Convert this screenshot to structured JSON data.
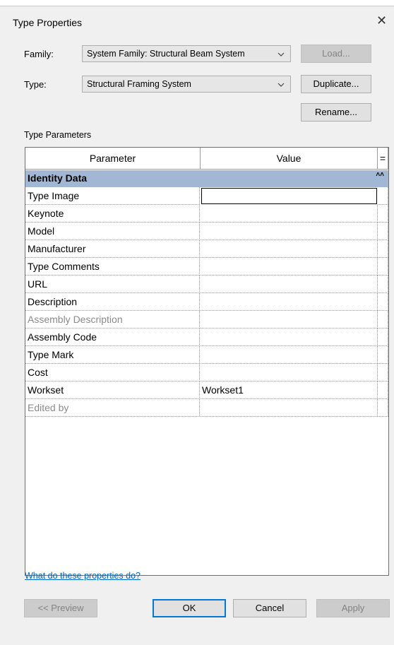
{
  "window": {
    "title": "Type Properties"
  },
  "family": {
    "label": "Family:",
    "value": "System Family: Structural Beam System"
  },
  "type": {
    "label": "Type:",
    "value": "Structural Framing System"
  },
  "buttons": {
    "load": "Load...",
    "duplicate": "Duplicate...",
    "rename": "Rename..."
  },
  "section_label": "Type Parameters",
  "table": {
    "headers": {
      "parameter": "Parameter",
      "value": "Value",
      "sort": "="
    },
    "group": "Identity Data",
    "rows": [
      {
        "parameter": "Type Image",
        "value": ""
      },
      {
        "parameter": "Keynote",
        "value": ""
      },
      {
        "parameter": "Model",
        "value": ""
      },
      {
        "parameter": "Manufacturer",
        "value": ""
      },
      {
        "parameter": "Type Comments",
        "value": ""
      },
      {
        "parameter": "URL",
        "value": ""
      },
      {
        "parameter": "Description",
        "value": ""
      },
      {
        "parameter": "Assembly Description",
        "value": ""
      },
      {
        "parameter": "Assembly Code",
        "value": ""
      },
      {
        "parameter": "Type Mark",
        "value": ""
      },
      {
        "parameter": "Cost",
        "value": ""
      },
      {
        "parameter": "Workset",
        "value": "Workset1"
      },
      {
        "parameter": "Edited by",
        "value": ""
      }
    ]
  },
  "help_link": "What do these properties do?",
  "footer": {
    "preview": "<< Preview",
    "ok": "OK",
    "cancel": "Cancel",
    "apply": "Apply"
  }
}
